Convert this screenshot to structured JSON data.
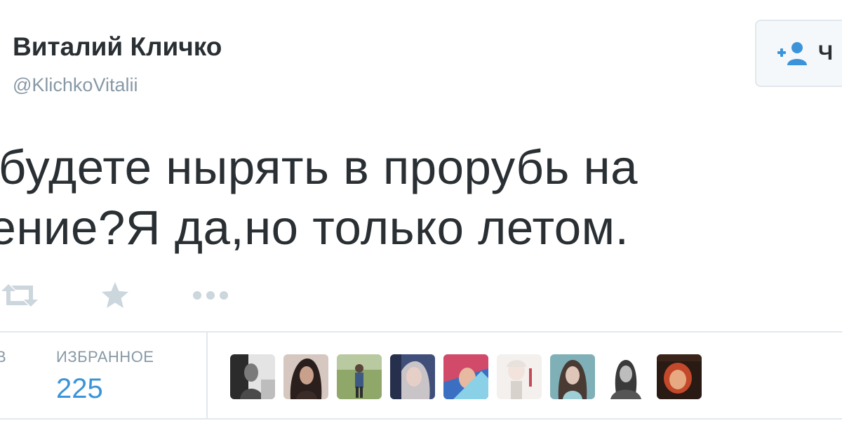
{
  "author": {
    "name": "Виталий Кличко",
    "handle": "@KlichkoVitalii"
  },
  "follow_button": {
    "label": "Ч",
    "icon": "add-user-icon"
  },
  "tweet": {
    "text_lines": [
      "ы будете нырять в прорубь на",
      "щение?Я да,но только летом."
    ]
  },
  "actions": {
    "icons": [
      "retweet-icon",
      "star-icon",
      "more-icon"
    ]
  },
  "stats": {
    "retweets_label_fragment": "В",
    "favorites_label": "ИЗБРАННОЕ",
    "favorites_count": "225"
  },
  "favorited_by": {
    "avatar_count": 9
  },
  "colors": {
    "link_blue": "#3b94d9",
    "muted_gray": "#8899a6",
    "text_dark": "#292f33",
    "divider": "#e1e8ed",
    "icon_gray": "#ccd6dd"
  }
}
